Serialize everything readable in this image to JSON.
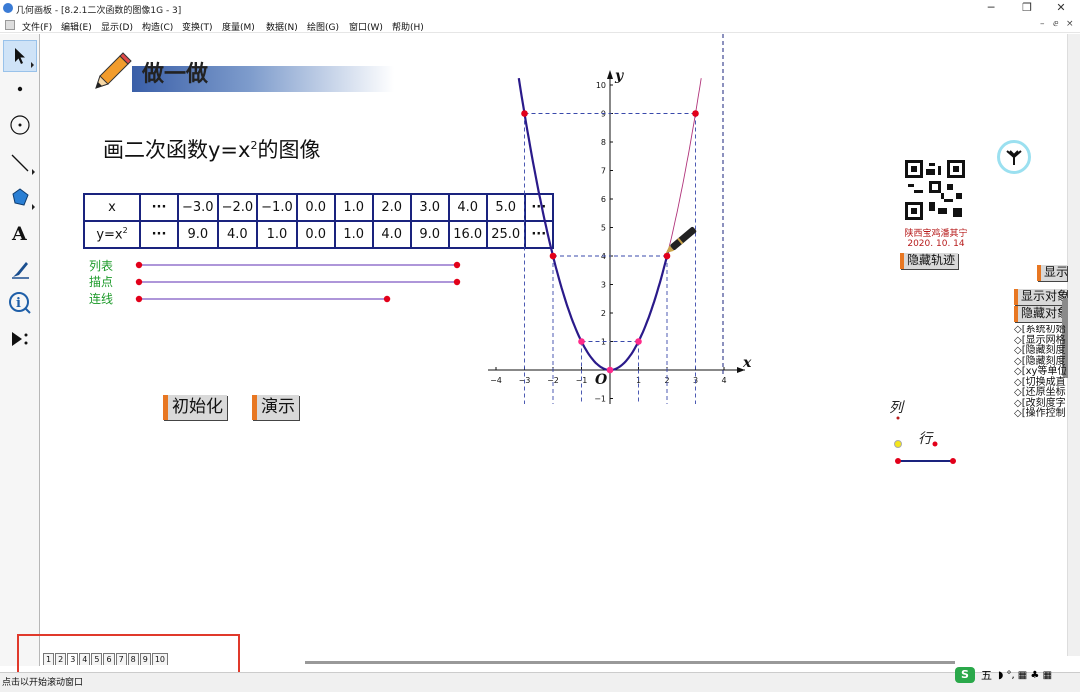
{
  "window": {
    "title": "几何画板 - [8.2.1二次函数的图像1G - 3]",
    "minimize": "─",
    "restore": "❐",
    "close": "✕"
  },
  "menu": [
    "文件(F)",
    "编辑(E)",
    "显示(D)",
    "构造(C)",
    "变换(T)",
    "度量(M)",
    "数据(N)",
    "绘图(G)",
    "窗口(W)",
    "帮助(H)"
  ],
  "mdi_controls": [
    "–",
    "ⅇ",
    "×"
  ],
  "tools": [
    "selection-arrow",
    "point",
    "compass",
    "straightedge",
    "polygon",
    "text",
    "marker",
    "information",
    "custom-tools"
  ],
  "slide": {
    "heading": "做一做",
    "task_prefix": "画二次函数y=x",
    "task_sup": "2",
    "task_suffix": "的图像",
    "table": {
      "row1_label": "x",
      "row2_label": "y=x",
      "row2_sup": "2",
      "ellipsis": "···",
      "x": [
        "−3.0",
        "−2.0",
        "−1.0",
        "0.0",
        "1.0",
        "2.0",
        "3.0",
        "4.0",
        "5.0"
      ],
      "y": [
        "9.0",
        "4.0",
        "1.0",
        "0.0",
        "1.0",
        "4.0",
        "9.0",
        "16.0",
        "25.0"
      ]
    },
    "sliders": [
      {
        "label": "列表",
        "level": 1.0
      },
      {
        "label": "描点",
        "level": 1.0
      },
      {
        "label": "连线",
        "level": 0.78
      }
    ],
    "buttons": {
      "init": "初始化",
      "demo": "演示"
    },
    "stamp_line1": "陕西宝鸡潘其宁",
    "stamp_line2": "2020. 10. 14",
    "hide_trace": "隐藏轨迹",
    "show_btn": "显示",
    "show_objects": "显示对象",
    "hide_objects": "隐藏对象",
    "side_list": [
      "◇[系统初始",
      "◇[显示网格",
      "◇[隐藏刻度",
      "◇[隐藏刻度",
      "◇[xy等单位",
      "◇[切换成直",
      "◇[还原坐标",
      "◇[改刻度字",
      "◇[操作控制"
    ],
    "col_label": "列",
    "row_label": "行"
  },
  "graph": {
    "x_axis_label": "x",
    "y_axis_label": "y",
    "origin": "O",
    "x_ticks": [
      "−4",
      "−3",
      "−2",
      "−1",
      "1",
      "2",
      "3",
      "4"
    ],
    "y_ticks": [
      "10",
      "9",
      "8",
      "7",
      "6",
      "5",
      "4",
      "3",
      "2",
      "1",
      "−1"
    ],
    "points": [
      [
        -3,
        9
      ],
      [
        -2,
        4
      ],
      [
        -1,
        1
      ],
      [
        0,
        0
      ],
      [
        1,
        1
      ],
      [
        2,
        4
      ],
      [
        3,
        9
      ]
    ]
  },
  "pages": [
    "1",
    "2",
    "3",
    "4",
    "5",
    "6",
    "7",
    "8",
    "9",
    "10"
  ],
  "current_page": "3",
  "status": "点击以开始滚动窗口",
  "ime": {
    "brand": "S",
    "mode": "五",
    "icons": "◗ °, ▦ ♣ ▦"
  }
}
